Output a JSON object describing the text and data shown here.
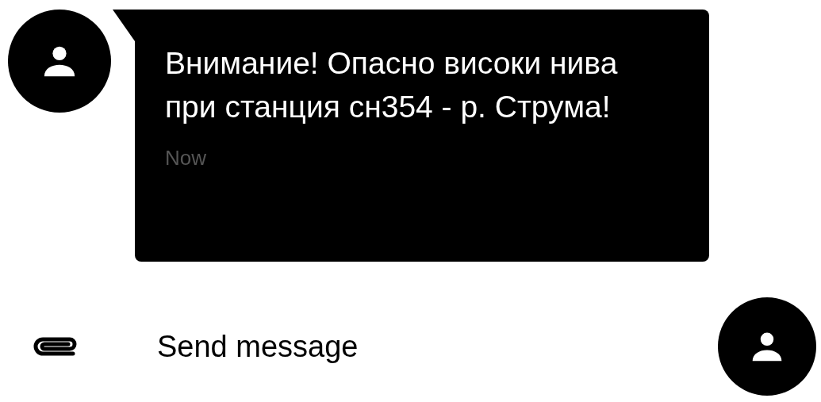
{
  "message": {
    "text": "Внимание! Опасно високи нива при станция сн354 - р. Струма!",
    "time": "Now"
  },
  "composer": {
    "placeholder": "Send message"
  }
}
